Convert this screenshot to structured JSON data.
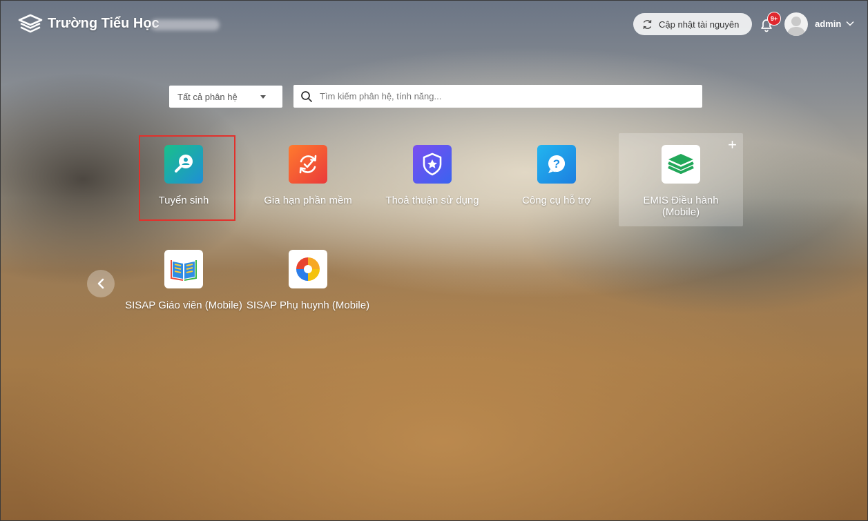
{
  "header": {
    "school_name": "Trường Tiểu Học",
    "update_button_label": "Cập nhật tài nguyên",
    "notification_badge": "9+",
    "username": "admin"
  },
  "filters": {
    "module_select_value": "Tất cả phân hệ",
    "search_placeholder": "Tìm kiếm phân hệ, tính năng..."
  },
  "apps": [
    {
      "label": "Tuyển sinh",
      "icon": "admission-search-icon",
      "color": "#17b08f"
    },
    {
      "label": "Gia hạn phần mềm",
      "icon": "renew-icon",
      "color": "#f2592c"
    },
    {
      "label": "Thoả thuận sử dụng",
      "icon": "shield-star-icon",
      "color": "#5b57f2"
    },
    {
      "label": "Công cụ hỗ trợ",
      "icon": "help-chat-icon",
      "color": "#1a9be8"
    },
    {
      "label": "EMIS Điều hành (Mobile)",
      "icon": "emis-logo-icon",
      "color": "#22a85a"
    },
    {
      "label": "SISAP Giáo viên (Mobile)",
      "icon": "book-icon",
      "color": "#2f8de4"
    },
    {
      "label": "SISAP Phụ huynh (Mobile)",
      "icon": "family-ring-icon",
      "color": "#e7442f"
    }
  ],
  "colors": {
    "highlight": "#e2302b",
    "badge": "#e0282e"
  }
}
